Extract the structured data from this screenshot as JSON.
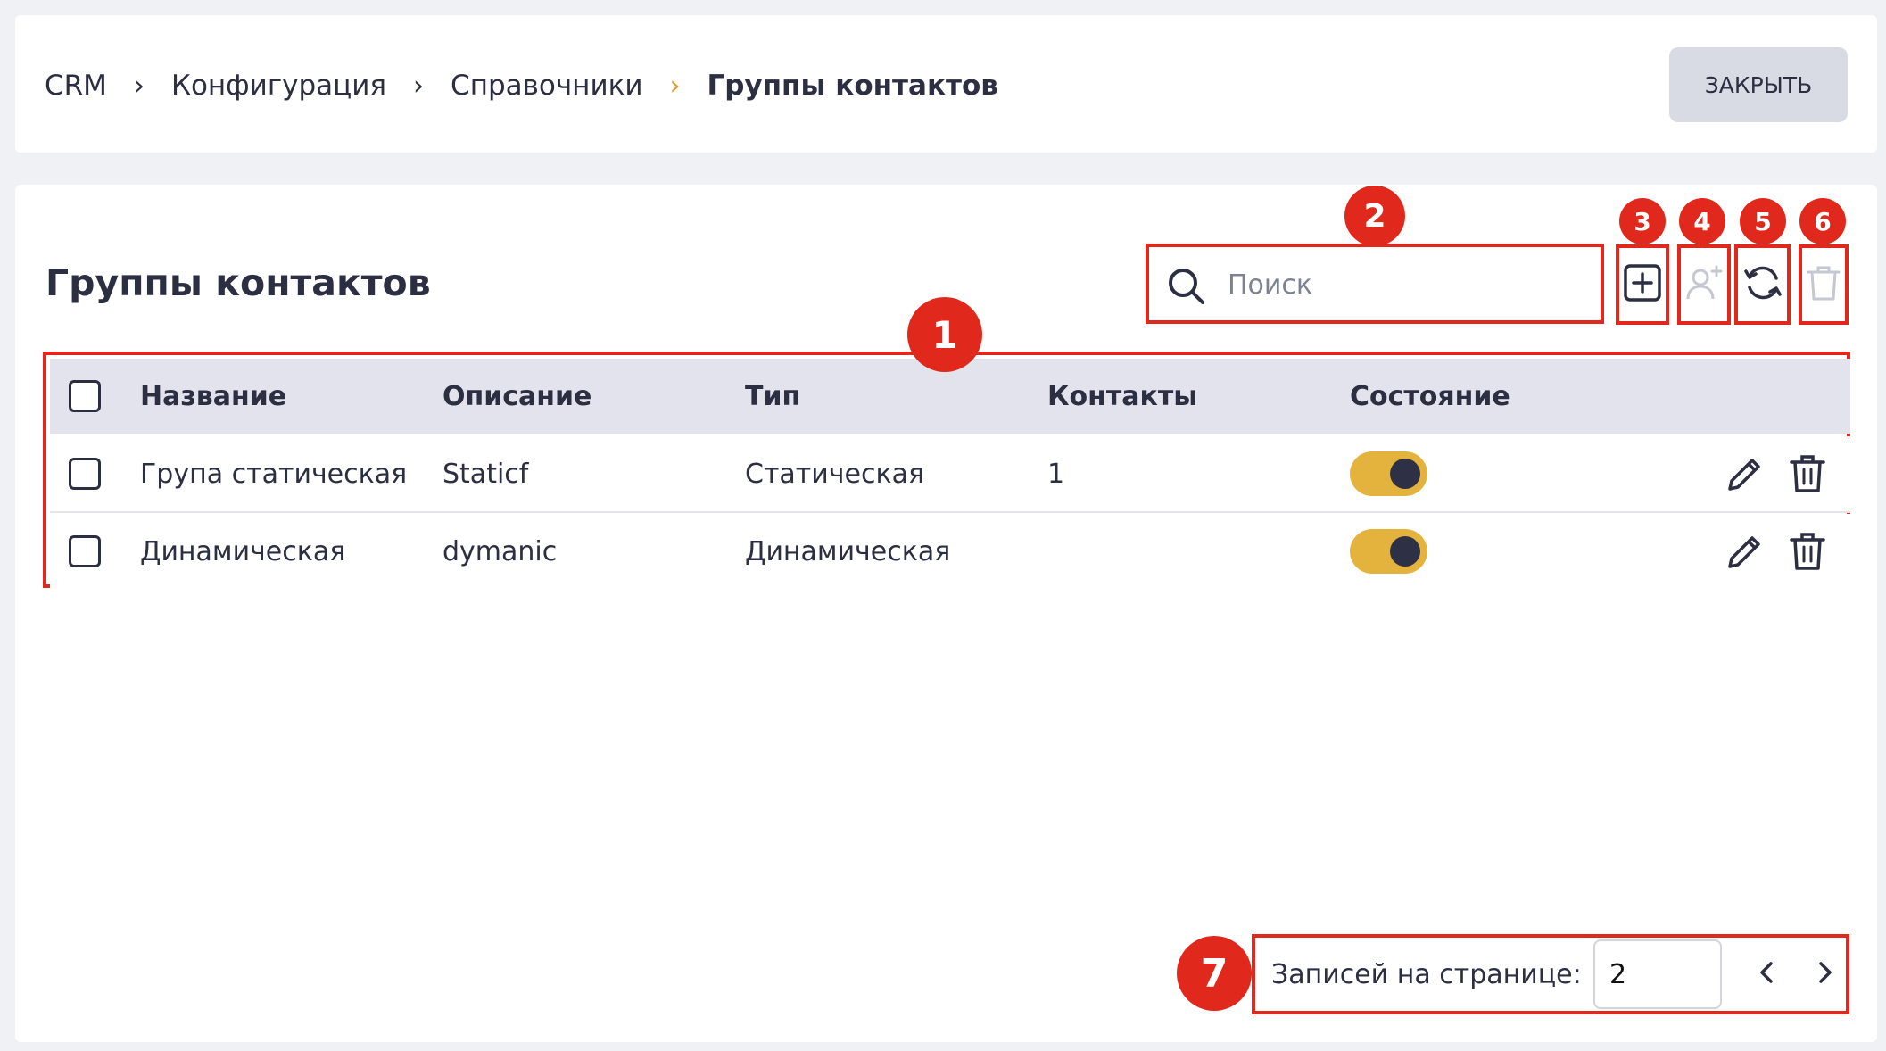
{
  "breadcrumb": {
    "items": [
      {
        "label": "CRM"
      },
      {
        "label": "Конфигурация"
      },
      {
        "label": "Справочники"
      },
      {
        "label": "Группы контактов"
      }
    ],
    "separator": "›",
    "accent_color": "#e09a2e"
  },
  "header": {
    "close_label": "ЗАКРЫТЬ"
  },
  "page": {
    "title": "Группы контактов"
  },
  "search": {
    "placeholder": "Поиск",
    "value": ""
  },
  "toolbar": {
    "icons": [
      "add-icon",
      "add-contact-icon",
      "refresh-icon",
      "trash-icon"
    ]
  },
  "table": {
    "columns": [
      "Название",
      "Описание",
      "Тип",
      "Контакты",
      "Состояние"
    ],
    "rows": [
      {
        "name": "Група статическая",
        "description": "Staticf",
        "type": "Статическая",
        "contacts": "1",
        "state": true
      },
      {
        "name": "Динамическая",
        "description": "dymanic",
        "type": "Динамическая",
        "contacts": "",
        "state": true
      }
    ]
  },
  "pagination": {
    "label": "Записей на странице:",
    "per_page": "2"
  },
  "annotations": {
    "labels": [
      "1",
      "2",
      "3",
      "4",
      "5",
      "6",
      "7"
    ],
    "color": "#e0281c"
  },
  "colors": {
    "toggle_on": "#e3b33d",
    "text": "#2c2f42",
    "header_bg": "#e2e3ec"
  }
}
